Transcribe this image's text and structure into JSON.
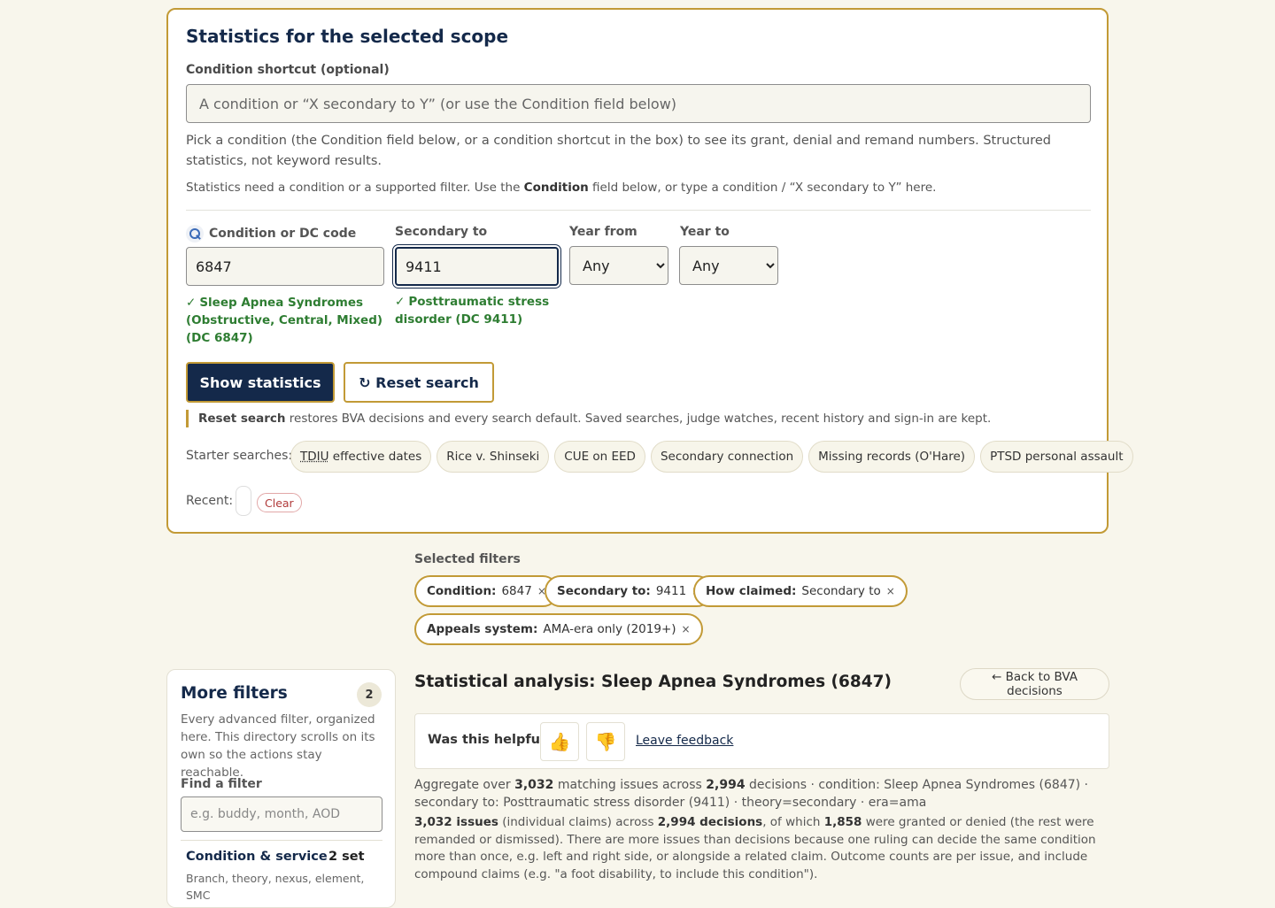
{
  "scope": {
    "title": "Statistics for the selected scope",
    "condition_shortcut_label": "Condition shortcut (optional)",
    "condition_shortcut_placeholder": "A condition or “X secondary to Y” (or use the Condition field below)",
    "help_text": "Pick a condition (the Condition field below, or a condition shortcut in the box) to see its grant, denial and remand numbers. Structured statistics, not keyword results.",
    "note_pre": "Statistics need a condition or a supported filter. Use the ",
    "note_bold": "Condition",
    "note_post": " field below, or type a condition / “X secondary to Y” here."
  },
  "fields": {
    "condition_label": "Condition or DC code",
    "condition_value": "6847",
    "condition_match": "Sleep Apnea Syndromes (Obstructive, Central, Mixed) (DC 6847)",
    "secondary_label": "Secondary to",
    "secondary_value": "9411",
    "secondary_match": "Posttraumatic stress disorder (DC 9411)",
    "year_from_label": "Year from",
    "year_from_value": "Any",
    "year_to_label": "Year to",
    "year_to_value": "Any"
  },
  "actions": {
    "show_label": "Show statistics",
    "reset_label": "↻ Reset search",
    "reset_note_bold": "Reset search",
    "reset_note_rest": " restores BVA decisions and every search default. Saved searches, judge watches, recent history and sign-in are kept."
  },
  "starters": {
    "label": "Starter searches:",
    "tdiu_abbr": "TDIU",
    "tdiu_rest": " effective dates",
    "items": [
      "Rice v. Shinseki",
      "CUE on EED",
      "Secondary connection",
      "Missing records (O'Hare)",
      "PTSD personal assault"
    ]
  },
  "recent": {
    "label": "Recent:",
    "clear_label": "Clear"
  },
  "selected_filters": {
    "label": "Selected filters",
    "pills": [
      {
        "key": "Condition:",
        "value": "6847"
      },
      {
        "key": "Secondary to:",
        "value": "9411"
      },
      {
        "key": "How claimed:",
        "value": "Secondary to"
      },
      {
        "key": "Appeals system:",
        "value": "AMA-era only (2019+)"
      }
    ],
    "remove_glyph": "×"
  },
  "more_filters": {
    "title": "More filters",
    "count": "2",
    "description": "Every advanced filter, organized here. This directory scrolls on its own so the actions stay reachable.",
    "find_label": "Find a filter",
    "find_placeholder": "e.g. buddy, month, AOD",
    "group_title": "Condition & service",
    "group_set": "2 set",
    "group_desc": "Branch, theory, nexus, element, SMC"
  },
  "analysis": {
    "title": "Statistical analysis: Sleep Apnea Syndromes (6847)",
    "back_label": "← Back to BVA decisions",
    "helpful_question": "Was this helpful?",
    "thumb_up": "👍",
    "thumb_down": "👎",
    "feedback_label": "Leave feedback",
    "agg_1": "Aggregate over ",
    "agg_issues": "3,032",
    "agg_2": " matching issues across ",
    "agg_decisions": "2,994",
    "agg_3": " decisions · condition: Sleep Apnea Syndromes (6847) · secondary to: Posttraumatic stress disorder (9411) · theory=secondary · era=ama",
    "issues_bold": "3,032 issues",
    "issues_1": " (individual claims) across ",
    "issues_dec": "2,994 decisions",
    "issues_2": ", of which ",
    "issues_num": "1,858",
    "issues_3": " were granted or denied (the rest were remanded or dismissed). There are more issues than decisions because one ruling can decide the same condition more than once, e.g. left and right side, or alongside a related claim. Outcome counts are per issue, and include compound claims (e.g. \"a foot disability, to include this condition\")."
  },
  "colors": {
    "accent": "#c29a36",
    "navy": "#14294a",
    "match_green": "#2e7d32",
    "background": "#f8f6ec"
  }
}
